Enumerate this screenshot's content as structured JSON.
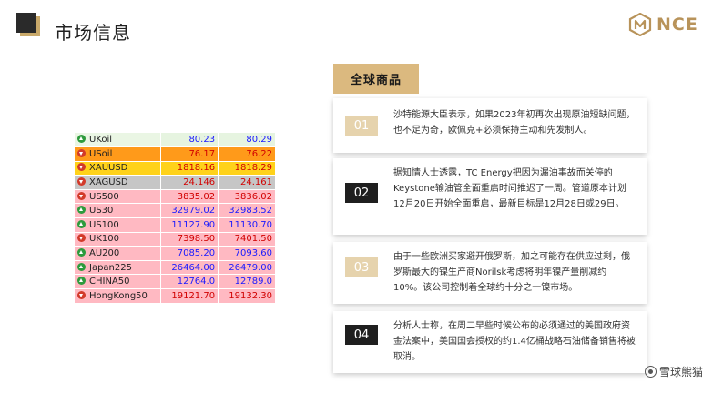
{
  "header": {
    "title": "市场信息",
    "logo_text": "NCE"
  },
  "quotes": [
    {
      "name": "UKoil",
      "dir": "up",
      "v1": "80.23",
      "v2": "80.29",
      "style": "green"
    },
    {
      "name": "USoil",
      "dir": "down",
      "v1": "76.17",
      "v2": "76.22",
      "style": "orange"
    },
    {
      "name": "XAUUSD",
      "dir": "down",
      "v1": "1818.16",
      "v2": "1818.29",
      "style": "yellow"
    },
    {
      "name": "XAGUSD",
      "dir": "down",
      "v1": "24.146",
      "v2": "24.161",
      "style": "gray"
    },
    {
      "name": "US500",
      "dir": "down",
      "v1": "3835.02",
      "v2": "3836.02",
      "style": "pink-red"
    },
    {
      "name": "US30",
      "dir": "up",
      "v1": "32979.02",
      "v2": "32983.52",
      "style": "pink-blue"
    },
    {
      "name": "US100",
      "dir": "up",
      "v1": "11127.90",
      "v2": "11130.70",
      "style": "pink-blue"
    },
    {
      "name": "UK100",
      "dir": "down",
      "v1": "7398.50",
      "v2": "7401.50",
      "style": "pink-red"
    },
    {
      "name": "AU200",
      "dir": "up",
      "v1": "7085.20",
      "v2": "7093.60",
      "style": "pink-blue"
    },
    {
      "name": "Japan225",
      "dir": "up",
      "v1": "26464.00",
      "v2": "26479.00",
      "style": "pink-blue"
    },
    {
      "name": "CHINA50",
      "dir": "up",
      "v1": "12764.0",
      "v2": "12789.0",
      "style": "pink-blue"
    },
    {
      "name": "HongKong50",
      "dir": "down",
      "v1": "19121.70",
      "v2": "19132.30",
      "style": "pink-red"
    }
  ],
  "section": {
    "label": "全球商品"
  },
  "news": [
    {
      "num": "01",
      "text": "沙特能源大臣表示，如果2023年初再次出现原油短缺问题，也不足为奇，欧佩克+必须保持主动和先发制人。"
    },
    {
      "num": "02",
      "text": "据知情人士透露，TC Energy把因为漏油事故而关停的Keystone输油管全面重启时间推迟了一周。管道原本计划12月20日开始全面重启，最新目标是12月28日或29日。"
    },
    {
      "num": "03",
      "text": "由于一些欧洲买家避开俄罗斯，加之可能存在供应过剩，俄罗斯最大的镍生产商Norilsk考虑将明年镍产量削减约10%。该公司控制着全球约十分之一镍市场。"
    },
    {
      "num": "04",
      "text": "分析人士称，在周二早些时候公布的必须通过的美国政府资金法案中，美国国会授权的约1.4亿桶战略石油储备销售将被取消。"
    }
  ],
  "watermark": {
    "text": "雪球熊猫"
  }
}
